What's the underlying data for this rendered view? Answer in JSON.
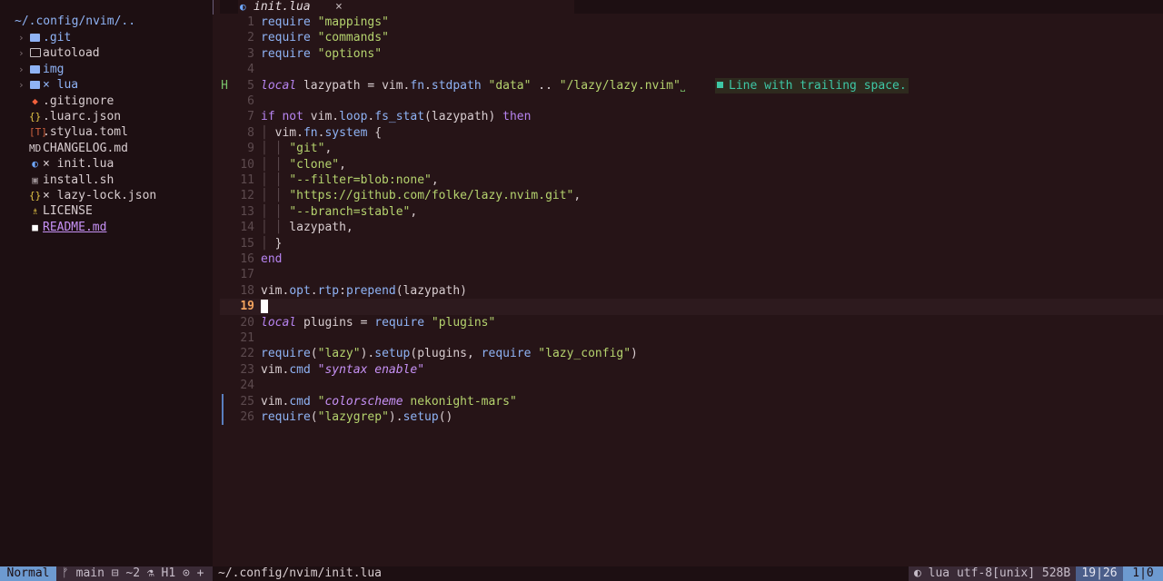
{
  "sidebar": {
    "root": "~/.config/nvim/..",
    "items": [
      {
        "chevron": "›",
        "icon": "folder",
        "name": ".git",
        "color": "#8fb3f5"
      },
      {
        "chevron": "›",
        "icon": "folder-open",
        "name": "autoload",
        "color": "#d8cdd0"
      },
      {
        "chevron": "›",
        "icon": "folder",
        "name": "img",
        "color": "#8fb3f5"
      },
      {
        "chevron": "›",
        "icon": "folder",
        "name": "× lua",
        "color": "#8fb3f5"
      },
      {
        "chevron": "",
        "icon": "◆",
        "name": ".gitignore",
        "color": "#f0603c"
      },
      {
        "chevron": "",
        "icon": "{}",
        "name": ".luarc.json",
        "color": "#e3c547"
      },
      {
        "chevron": "",
        "icon": "[T]",
        "name": ".stylua.toml",
        "color": "#d0623f"
      },
      {
        "chevron": "",
        "icon": "MD",
        "name": "CHANGELOG.md",
        "color": "#d8cdd0"
      },
      {
        "chevron": "",
        "icon": "◐",
        "name": "× init.lua",
        "color": "#6fa8ff"
      },
      {
        "chevron": "",
        "icon": "▣",
        "name": "install.sh",
        "color": "#9a8f93"
      },
      {
        "chevron": "",
        "icon": "{}",
        "name": "× lazy-lock.json",
        "color": "#e3c547"
      },
      {
        "chevron": "",
        "icon": "♗",
        "name": "LICENSE",
        "color": "#e3c547"
      },
      {
        "chevron": "",
        "icon": "■",
        "name": "README.md",
        "color": "#ffffff"
      }
    ]
  },
  "tab": {
    "label": "init.lua",
    "close": "×"
  },
  "editor": {
    "current_line": 19,
    "lines": [
      {
        "n": "1",
        "html": "<span class='fn'>require</span> <span class='str'>\"mappings\"</span>"
      },
      {
        "n": "2",
        "html": "<span class='fn'>require</span> <span class='str'>\"commands\"</span>"
      },
      {
        "n": "3",
        "html": "<span class='fn'>require</span> <span class='str'>\"options\"</span>"
      },
      {
        "n": "4",
        "html": ""
      },
      {
        "n": "5",
        "sign": "H",
        "html": "<span class='itkw'>local</span> lazypath <span class='op'>=</span> vim.<span class='fn'>fn</span>.<span class='fn'>stdpath</span> <span class='str'>\"data\"</span> <span class='op'>..</span> <span class='str'>\"/lazy/lazy.nvim\"</span><span class='trail'>˽</span>"
      },
      {
        "n": "6",
        "html": ""
      },
      {
        "n": "7",
        "html": "<span class='kw'>if</span> <span class='kw'>not</span> vim.<span class='fn'>loop</span>.<span class='fn'>fs_stat</span>(lazypath) <span class='kw'>then</span>"
      },
      {
        "n": "8",
        "html": "<span class='indent'>│</span> vim.<span class='fn'>fn</span>.<span class='fn'>system</span> {"
      },
      {
        "n": "9",
        "html": "<span class='indent'>│ │</span> <span class='str'>\"git\"</span>,"
      },
      {
        "n": "10",
        "html": "<span class='indent'>│ │</span> <span class='str'>\"clone\"</span>,"
      },
      {
        "n": "11",
        "html": "<span class='indent'>│ │</span> <span class='str'>\"--filter=blob:none\"</span>,"
      },
      {
        "n": "12",
        "html": "<span class='indent'>│ │</span> <span class='str'>\"https://github.com/folke/lazy.nvim.git\"</span>,"
      },
      {
        "n": "13",
        "html": "<span class='indent'>│ │</span> <span class='str'>\"--branch=stable\"</span>,"
      },
      {
        "n": "14",
        "html": "<span class='indent'>│ │</span> lazypath,"
      },
      {
        "n": "15",
        "html": "<span class='indent'>│</span> }"
      },
      {
        "n": "16",
        "html": "<span class='kw'>end</span>"
      },
      {
        "n": "17",
        "html": ""
      },
      {
        "n": "18",
        "html": "vim.<span class='fn'>opt</span>.<span class='fn'>rtp</span>:<span class='fn'>prepend</span>(lazypath)"
      },
      {
        "n": "19",
        "html": "<span class='cursor'></span>"
      },
      {
        "n": "20",
        "html": "<span class='itkw'>local</span> plugins <span class='op'>=</span> <span class='fn'>require</span> <span class='str'>\"plugins\"</span>"
      },
      {
        "n": "21",
        "html": ""
      },
      {
        "n": "22",
        "html": "<span class='fn'>require</span>(<span class='str'>\"lazy\"</span>).<span class='fn'>setup</span>(plugins, <span class='fn'>require</span> <span class='str'>\"lazy_config\"</span>)"
      },
      {
        "n": "23",
        "html": "vim.<span class='fn'>cmd</span> <span class='itstr'>\"syntax enable\"</span>"
      },
      {
        "n": "24",
        "html": ""
      },
      {
        "n": "25",
        "gitbar": true,
        "html": "vim.<span class='fn'>cmd</span> <span class='str'>\"</span><span class='itstr'>colorscheme</span> <span class='str'>nekonight-mars\"</span>"
      },
      {
        "n": "26",
        "gitbar": true,
        "html": "<span class='fn'>require</span>(<span class='str'>\"lazygrep\"</span>).<span class='fn'>setup</span>()"
      }
    ],
    "diagnostic": {
      "line": 5,
      "text": "Line with trailing space."
    }
  },
  "statusbar": {
    "mode": "Normal",
    "branch": "ᚠ main ⊟ ~2 ⚗ H1 ⊙ +",
    "path": "~/.config/nvim/init.lua",
    "filetype": "◐ lua utf-8[unix] 528B",
    "position": "19|26",
    "selection": "1|0"
  },
  "colors": {
    "accent": "#6d9ad0",
    "background": "#261417",
    "sidebar": "#1d0f12"
  }
}
